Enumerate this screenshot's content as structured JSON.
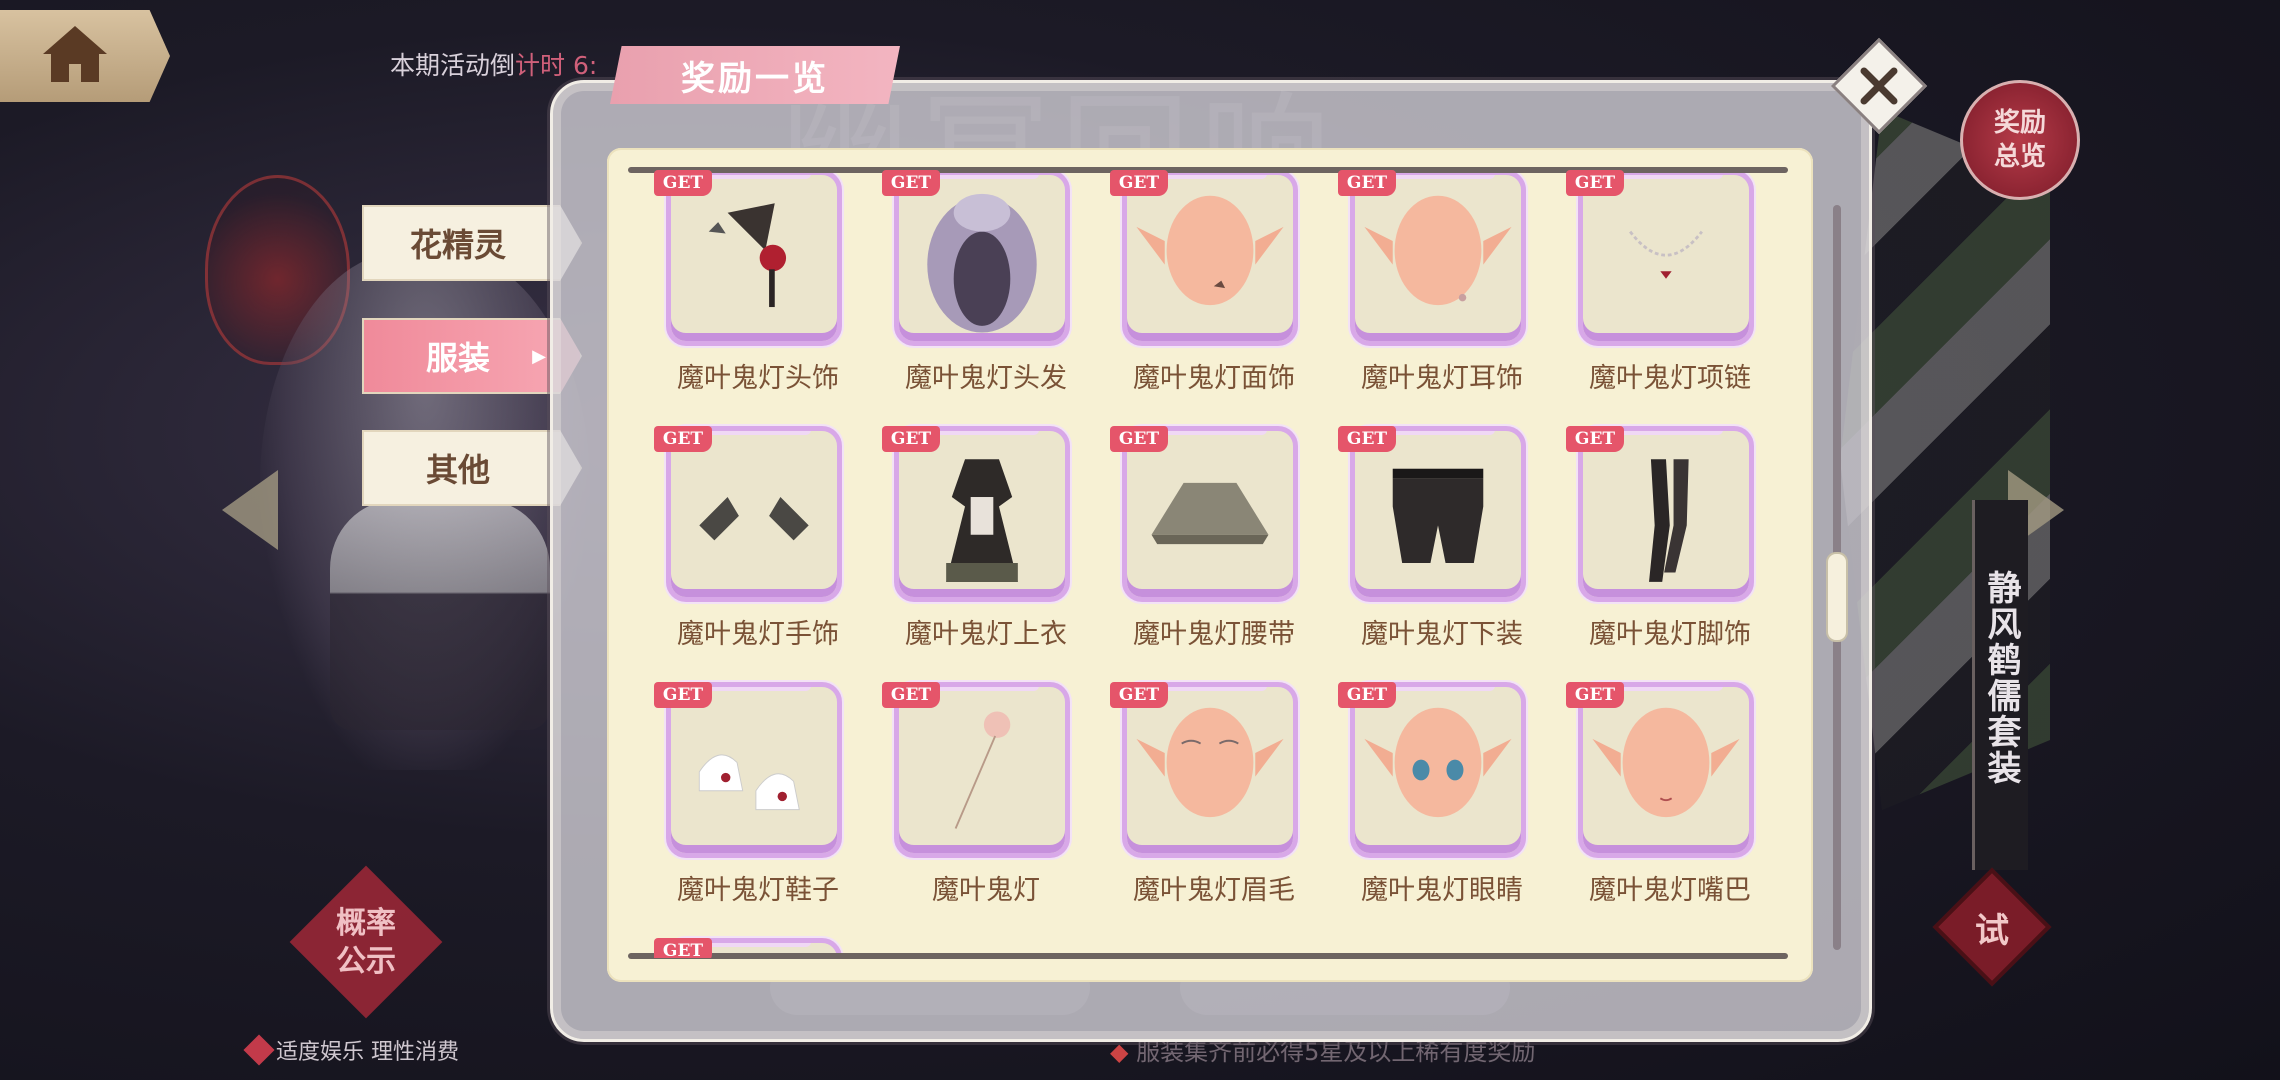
{
  "header": {
    "countdown_prefix": "本期活动倒",
    "countdown_red": "计时 6:",
    "panel_title": "奖励一览"
  },
  "side_tabs": [
    {
      "label": "花精灵",
      "active": false
    },
    {
      "label": "服装",
      "active": true
    },
    {
      "label": "其他",
      "active": false
    }
  ],
  "right_buttons": {
    "overview_line1": "奖励",
    "overview_line2": "总览",
    "suit_name": "静风鹤儒套装",
    "try_label": "试"
  },
  "left_buttons": {
    "prob_line1": "概率",
    "prob_line2": "公示",
    "bottom_note": "适度娱乐  理性消费"
  },
  "background": {
    "ghost_title": "幽冥回响",
    "notice": "服装集齐前必得5星及以上稀有度奖励"
  },
  "get_badge": "GET",
  "items": [
    {
      "label": "魔叶鬼灯头饰",
      "icon": "hair-ornament-icon"
    },
    {
      "label": "魔叶鬼灯头发",
      "icon": "hair-icon"
    },
    {
      "label": "魔叶鬼灯面饰",
      "icon": "face-ornament-icon"
    },
    {
      "label": "魔叶鬼灯耳饰",
      "icon": "earring-icon"
    },
    {
      "label": "魔叶鬼灯项链",
      "icon": "necklace-icon"
    },
    {
      "label": "魔叶鬼灯手饰",
      "icon": "gloves-icon"
    },
    {
      "label": "魔叶鬼灯上衣",
      "icon": "dress-icon"
    },
    {
      "label": "魔叶鬼灯腰带",
      "icon": "skirt-icon"
    },
    {
      "label": "魔叶鬼灯下装",
      "icon": "shorts-icon"
    },
    {
      "label": "魔叶鬼灯脚饰",
      "icon": "stockings-icon"
    },
    {
      "label": "魔叶鬼灯鞋子",
      "icon": "shoes-icon"
    },
    {
      "label": "魔叶鬼灯",
      "icon": "wand-icon"
    },
    {
      "label": "魔叶鬼灯眉毛",
      "icon": "eyebrows-icon"
    },
    {
      "label": "魔叶鬼灯眼睛",
      "icon": "eyes-icon"
    },
    {
      "label": "魔叶鬼灯嘴巴",
      "icon": "mouth-icon"
    },
    {
      "label": "",
      "icon": "partial-item-icon"
    }
  ],
  "colors": {
    "accent_pink": "#f08a9a",
    "get_red": "#e5556a",
    "card_border": "#d8a8e8",
    "label_brown": "#7a5236"
  }
}
